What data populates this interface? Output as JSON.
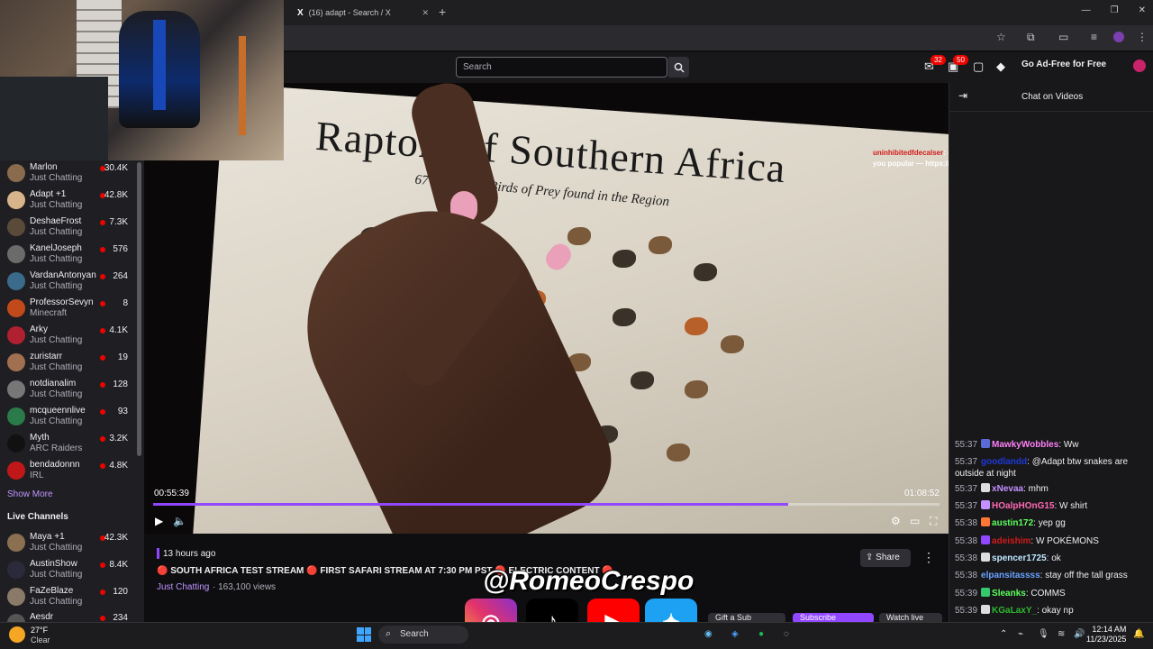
{
  "browser": {
    "tab_title": "(16) adapt - Search / X",
    "tab_icon": "X",
    "new_tab": "+",
    "controls": [
      "—",
      "❐",
      "✕"
    ]
  },
  "twitch": {
    "search_placeholder": "Search",
    "notif_badge_1": "32",
    "notif_badge_2": "50",
    "ad_free_label": "Go Ad-Free for Free"
  },
  "video": {
    "time_current": "00:55:39",
    "time_total": "01:08:52",
    "progress_fraction": 0.808,
    "paper_title": "Raptors of Southern Africa",
    "paper_subtitle": "67 Species of Birds of Prey found in the Region",
    "overlay_user": "uninhibitedfdecalser",
    "overlay_text": ": @romezcity Would you like many viewers? Let's make you popular — https://nezhna.com"
  },
  "sidebar": {
    "channels": [
      {
        "name": "Marlon",
        "game": "Just Chatting",
        "viewers": "30.4K",
        "color": "#8a6b4e"
      },
      {
        "name": "Adapt +1",
        "game": "Just Chatting",
        "viewers": "42.8K",
        "color": "#d7b48a"
      },
      {
        "name": "DeshaeFrost",
        "game": "Just Chatting",
        "viewers": "7.3K",
        "color": "#5a4a3a"
      },
      {
        "name": "KanelJoseph",
        "game": "Just Chatting",
        "viewers": "576",
        "color": "#6b6b6b"
      },
      {
        "name": "VardanAntonyan",
        "game": "Just Chatting",
        "viewers": "264",
        "color": "#3b6b8a"
      },
      {
        "name": "ProfessorSevyn",
        "game": "Minecraft",
        "viewers": "8",
        "color": "#c24a1a"
      },
      {
        "name": "Arky",
        "game": "Just Chatting",
        "viewers": "4.1K",
        "color": "#b02030"
      },
      {
        "name": "zuristarr",
        "game": "Just Chatting",
        "viewers": "19",
        "color": "#a07050"
      },
      {
        "name": "notdianalim",
        "game": "Just Chatting",
        "viewers": "128",
        "color": "#777"
      },
      {
        "name": "mcqueennlive",
        "game": "Just Chatting",
        "viewers": "93",
        "color": "#2a7a4a"
      },
      {
        "name": "Myth",
        "game": "ARC Raiders",
        "viewers": "3.2K",
        "color": "#111"
      },
      {
        "name": "bendadonnn",
        "game": "IRL",
        "viewers": "4.8K",
        "color": "#c01818"
      }
    ],
    "show_more": "Show More",
    "live_header": "Live Channels",
    "live": [
      {
        "name": "Maya +1",
        "game": "Just Chatting",
        "viewers": "42.3K",
        "color": "#8a7050"
      },
      {
        "name": "AustinShow",
        "game": "Just Chatting",
        "viewers": "8.4K",
        "color": "#2a2a3a"
      },
      {
        "name": "FaZeBlaze",
        "game": "Just Chatting",
        "viewers": "120",
        "color": "#8a7a6a"
      },
      {
        "name": "Aesdr",
        "game": "",
        "viewers": "234",
        "color": "#555"
      }
    ]
  },
  "below": {
    "ago": "13 hours ago",
    "title": "🔴 SOUTH AFRICA TEST STREAM 🔴 FIRST SAFARI STREAM AT 7:30 PM PST 🔴 ELECTRIC CONTENT 🔴",
    "category": "Just Chatting",
    "views": "· 163,100 views",
    "share": "Share",
    "watermark": "@RomeoCrespo",
    "gift": "Gift a Sub",
    "subscribe": "Subscribe",
    "watch_live": "Watch live"
  },
  "chat": {
    "title": "Chat on Videos",
    "messages": [
      {
        "time": "55:37",
        "user": "MawkyWobbles",
        "color": "#ff7ff6",
        "text": ": Ww",
        "badge": "#5a6bd6"
      },
      {
        "time": "55:37",
        "user": "goodlandd",
        "color": "#1e3ad6",
        "text": ": @Adapt btw snakes are outside at night",
        "badge": ""
      },
      {
        "time": "55:37",
        "user": "xNevaa",
        "color": "#c490ff",
        "text": ": mhm",
        "badge": "#ddd"
      },
      {
        "time": "55:37",
        "user": "HOalpHOnG15",
        "color": "#ff69b4",
        "text": ": W shirt",
        "badge": "#c490ff"
      },
      {
        "time": "55:38",
        "user": "austin172",
        "color": "#5cff5c",
        "text": ": yep gg",
        "badge": "#ff7733"
      },
      {
        "time": "55:38",
        "user": "adeishim",
        "color": "#d21a1a",
        "text": ": W POKÉMONS",
        "badge": "#9147ff"
      },
      {
        "time": "55:38",
        "user": "spencer1725",
        "color": "#bfe9ff",
        "text": ": ok",
        "badge": "#ddd"
      },
      {
        "time": "55:38",
        "user": "elpansitassss",
        "color": "#6aa2ff",
        "text": ": stay off the tall grass",
        "badge": ""
      },
      {
        "time": "55:39",
        "user": "Sleanks",
        "color": "#5cff5c",
        "text": ": COMMS",
        "badge": "#35c96e"
      },
      {
        "time": "55:39",
        "user": "KGaLaxY_",
        "color": "#2eb82e",
        "text": ": okay np",
        "badge": "#ddd"
      }
    ]
  },
  "taskbar": {
    "temp": "27°F",
    "weather": "Clear",
    "search": "Search",
    "time": "12:14 AM",
    "date": "11/23/2025"
  }
}
